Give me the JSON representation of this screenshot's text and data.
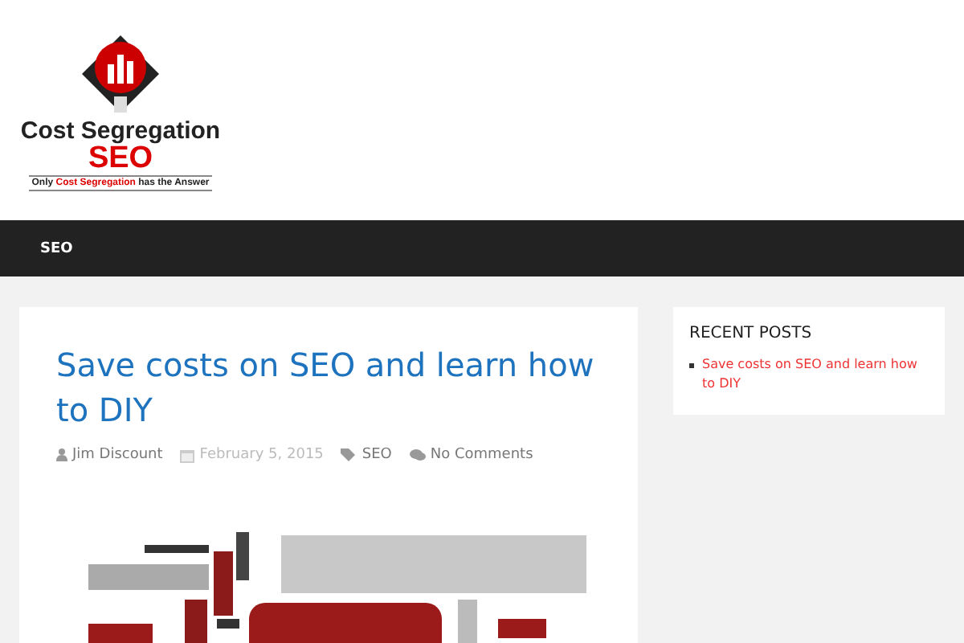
{
  "logo": {
    "title": "Cost Segregation",
    "subtitle": "SEO",
    "tagline_parts": [
      "Only ",
      "Cost Segregation",
      " has the Answer"
    ]
  },
  "nav": {
    "items": [
      {
        "label": "SEO",
        "selected": false
      }
    ]
  },
  "post": {
    "title": "Save costs on SEO and learn how to DIY",
    "author": "Jim Discount",
    "date": "February 5, 2015",
    "category": "SEO",
    "comments": "No Comments"
  },
  "sidebar": {
    "heading": "RECENT POSTS",
    "links": [
      "Save costs on SEO and learn how to DIY"
    ]
  }
}
